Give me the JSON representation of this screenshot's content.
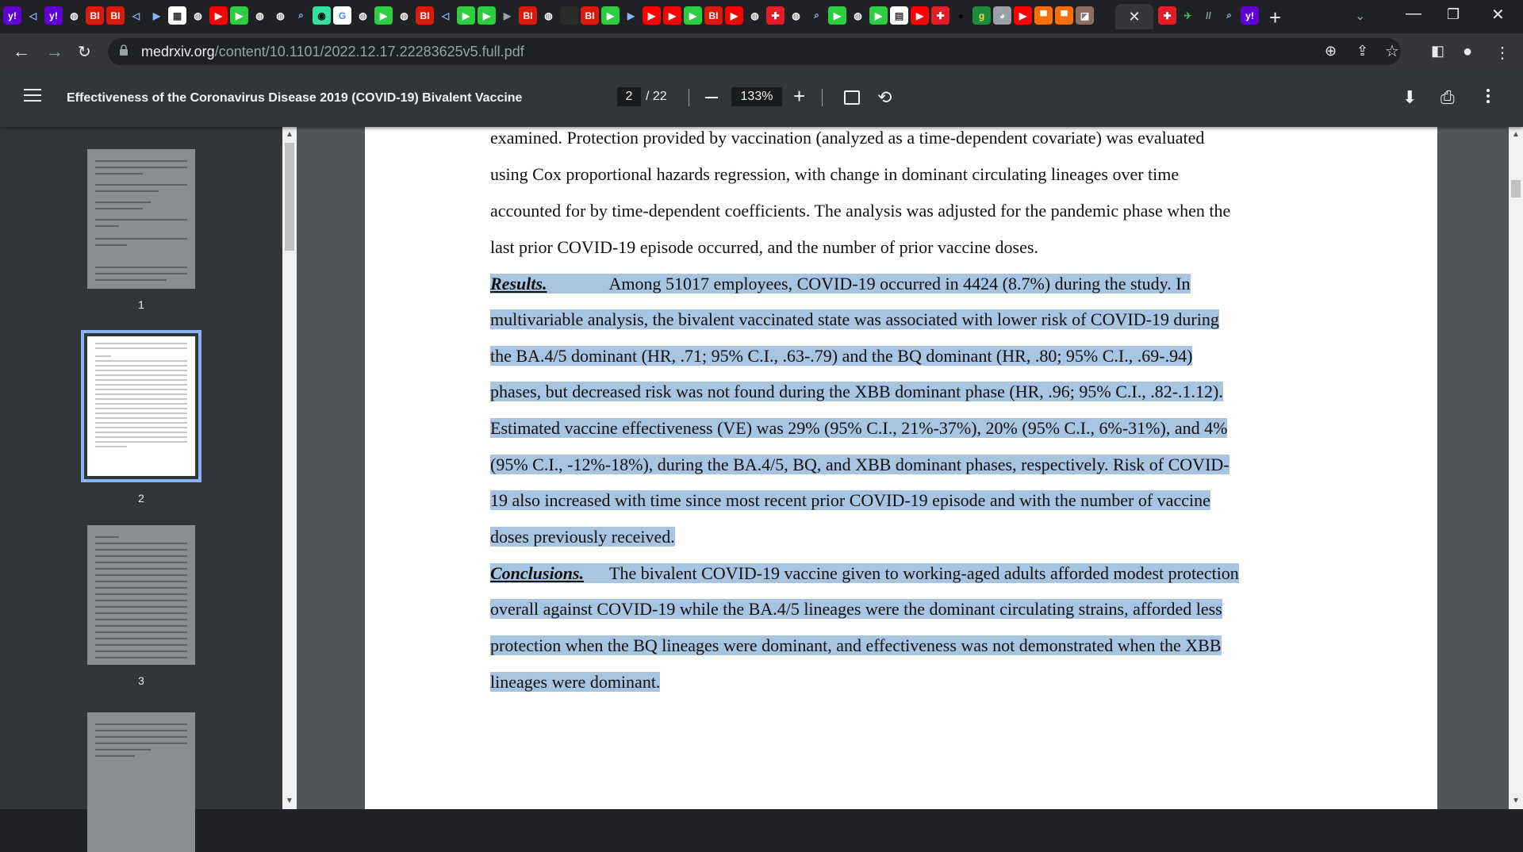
{
  "browser": {
    "tab_favicons": [
      {
        "icon": "yahoo-icon",
        "glyph": "y!",
        "bg": "#5f01d1",
        "fg": "#ffffff"
      },
      {
        "icon": "brave-icon",
        "glyph": "◁",
        "bg": "#202124",
        "fg": "#8ab4f8"
      },
      {
        "icon": "yahoo-icon",
        "glyph": "y!",
        "bg": "#5f01d1",
        "fg": "#ffffff"
      },
      {
        "icon": "globe-icon",
        "glyph": "◍",
        "bg": "#202124",
        "fg": "#ffffff"
      },
      {
        "icon": "bi-icon",
        "glyph": "BI",
        "bg": "#d81b0c",
        "fg": "#ffffff"
      },
      {
        "icon": "bi-icon",
        "glyph": "BI",
        "bg": "#d81b0c",
        "fg": "#ffffff"
      },
      {
        "icon": "brave-icon",
        "glyph": "◁",
        "bg": "#202124",
        "fg": "#8ab4f8"
      },
      {
        "icon": "media-icon",
        "glyph": "▶",
        "bg": "#202124",
        "fg": "#8ab4f8"
      },
      {
        "icon": "qr-icon",
        "glyph": "▦",
        "bg": "#ffffff",
        "fg": "#333333"
      },
      {
        "icon": "globe-icon",
        "glyph": "◍",
        "bg": "#202124",
        "fg": "#ffffff"
      },
      {
        "icon": "youtube-icon",
        "glyph": "▶",
        "bg": "#ff0000",
        "fg": "#ffffff"
      },
      {
        "icon": "play-icon",
        "glyph": "▶",
        "bg": "#2ecc40",
        "fg": "#ffffff"
      },
      {
        "icon": "globe-icon",
        "glyph": "◍",
        "bg": "#202124",
        "fg": "#ffffff"
      },
      {
        "icon": "globe-icon",
        "glyph": "◍",
        "bg": "#202124",
        "fg": "#ffffff"
      },
      {
        "icon": "search-icon",
        "glyph": "⌕",
        "bg": "#202124",
        "fg": "#8ab4f8"
      },
      {
        "icon": "tripadvisor-icon",
        "glyph": "◉",
        "bg": "#34e0a1",
        "fg": "#000000"
      },
      {
        "icon": "google-icon",
        "glyph": "G",
        "bg": "#ffffff",
        "fg": "#4285f4"
      },
      {
        "icon": "globe-icon",
        "glyph": "◍",
        "bg": "#202124",
        "fg": "#ffffff"
      },
      {
        "icon": "play-icon",
        "glyph": "▶",
        "bg": "#2ecc40",
        "fg": "#ffffff"
      },
      {
        "icon": "globe-icon",
        "glyph": "◍",
        "bg": "#202124",
        "fg": "#ffffff"
      },
      {
        "icon": "bi-icon",
        "glyph": "BI",
        "bg": "#d81b0c",
        "fg": "#ffffff"
      },
      {
        "icon": "brave-icon",
        "glyph": "◁",
        "bg": "#202124",
        "fg": "#8ab4f8"
      },
      {
        "icon": "play-icon",
        "glyph": "▶",
        "bg": "#2ecc40",
        "fg": "#ffffff"
      },
      {
        "icon": "play-icon",
        "glyph": "▶",
        "bg": "#2ecc40",
        "fg": "#ffffff"
      },
      {
        "icon": "media-icon",
        "glyph": "▶",
        "bg": "#202124",
        "fg": "#9aa0a6"
      },
      {
        "icon": "bi-icon",
        "glyph": "BI",
        "bg": "#d81b0c",
        "fg": "#ffffff"
      },
      {
        "icon": "globe-icon",
        "glyph": "◍",
        "bg": "#202124",
        "fg": "#ffffff"
      },
      {
        "icon": "blank-icon",
        "glyph": "",
        "bg": "#2b2b2b",
        "fg": "#ffffff"
      },
      {
        "icon": "bi-icon",
        "glyph": "BI",
        "bg": "#d81b0c",
        "fg": "#ffffff"
      },
      {
        "icon": "play-icon",
        "glyph": "▶",
        "bg": "#2ecc40",
        "fg": "#ffffff"
      },
      {
        "icon": "media-icon",
        "glyph": "▶",
        "bg": "#202124",
        "fg": "#8ab4f8"
      },
      {
        "icon": "youtube-icon",
        "glyph": "▶",
        "bg": "#ff0000",
        "fg": "#ffffff"
      },
      {
        "icon": "youtube-icon",
        "glyph": "▶",
        "bg": "#ff0000",
        "fg": "#ffffff"
      },
      {
        "icon": "play-icon",
        "glyph": "▶",
        "bg": "#2ecc40",
        "fg": "#ffffff"
      },
      {
        "icon": "bi-icon",
        "glyph": "BI",
        "bg": "#d81b0c",
        "fg": "#ffffff"
      },
      {
        "icon": "youtube-icon",
        "glyph": "▶",
        "bg": "#ff0000",
        "fg": "#ffffff"
      },
      {
        "icon": "globe-icon",
        "glyph": "◍",
        "bg": "#202124",
        "fg": "#ffffff"
      },
      {
        "icon": "gift-icon",
        "glyph": "✚",
        "bg": "#e41e26",
        "fg": "#ffffff"
      },
      {
        "icon": "globe-icon",
        "glyph": "◍",
        "bg": "#202124",
        "fg": "#ffffff"
      },
      {
        "icon": "search-icon",
        "glyph": "⌕",
        "bg": "#202124",
        "fg": "#8ab4f8"
      },
      {
        "icon": "play-icon",
        "glyph": "▶",
        "bg": "#2ecc40",
        "fg": "#ffffff"
      },
      {
        "icon": "globe-icon",
        "glyph": "◍",
        "bg": "#202124",
        "fg": "#ffffff"
      },
      {
        "icon": "play-icon",
        "glyph": "▶",
        "bg": "#2ecc40",
        "fg": "#ffffff"
      },
      {
        "icon": "news-icon",
        "glyph": "▤",
        "bg": "#ffffff",
        "fg": "#333333"
      },
      {
        "icon": "youtube-icon",
        "glyph": "▶",
        "bg": "#ff0000",
        "fg": "#ffffff"
      },
      {
        "icon": "gift-icon",
        "glyph": "✚",
        "bg": "#e41e26",
        "fg": "#ffffff"
      },
      {
        "icon": "circle-icon",
        "glyph": "●",
        "bg": "#202124",
        "fg": "#000000"
      },
      {
        "icon": "g-icon",
        "glyph": "g",
        "bg": "#1e8a3c",
        "fg": "#ffd54f"
      },
      {
        "icon": "avatar-icon",
        "glyph": "◕",
        "bg": "#9aa0a6",
        "fg": "#ffffff"
      },
      {
        "icon": "youtube-icon",
        "glyph": "▶",
        "bg": "#ff0000",
        "fg": "#ffffff"
      },
      {
        "icon": "bookmark-icon",
        "glyph": "▀",
        "bg": "#ff6f00",
        "fg": "#ffffff"
      },
      {
        "icon": "bookmark-icon",
        "glyph": "▀",
        "bg": "#ff6f00",
        "fg": "#ffffff"
      },
      {
        "icon": "photo-icon",
        "glyph": "◪",
        "bg": "#8d6e63",
        "fg": "#ffffff"
      }
    ],
    "active_tab_close": "✕",
    "tail_favicons": [
      {
        "icon": "gift-icon",
        "glyph": "✚",
        "bg": "#e41e26",
        "fg": "#ffffff"
      },
      {
        "icon": "shopping-icon",
        "glyph": "✈",
        "bg": "#202124",
        "fg": "#4caf50"
      },
      {
        "icon": "grid-icon",
        "glyph": "//",
        "bg": "#202124",
        "fg": "#9aa0a6"
      },
      {
        "icon": "search-icon",
        "glyph": "⌕",
        "bg": "#202124",
        "fg": "#8ab4f8"
      },
      {
        "icon": "yahoo-icon",
        "glyph": "y!",
        "bg": "#5f01d1",
        "fg": "#ffffff"
      }
    ],
    "new_tab_glyph": "+",
    "url_host": "medrxiv.org",
    "url_path": "/content/10.1101/2022.12.17.22283625v5.full.pdf"
  },
  "pdf_toolbar": {
    "title": "Effectiveness of the Coronavirus Disease 2019 (COVID-19) Bivalent Vaccine",
    "current_page": "2",
    "total_pages": "/ 22",
    "zoom": "133%"
  },
  "sidebar": {
    "thumbnails": [
      {
        "label": "1"
      },
      {
        "label": "2"
      },
      {
        "label": "3"
      }
    ]
  },
  "document": {
    "lines": [
      {
        "label": "",
        "text": "examined. Protection provided by vaccination (analyzed as a time-dependent covariate) was evaluated",
        "hl": false
      },
      {
        "label": "",
        "text": "using Cox proportional hazards regression, with change in dominant circulating lineages over time",
        "hl": false
      },
      {
        "label": "",
        "text": "accounted for by time-dependent coefficients. The analysis was adjusted for the pandemic phase when the",
        "hl": false
      },
      {
        "label": "",
        "text": "last prior COVID-19 episode occurred, and the number of prior vaccine doses.",
        "hl": false
      },
      {
        "label": "Results.",
        "text": "Among 51017 employees, COVID-19 occurred in 4424 (8.7%) during the study. In",
        "hl": true
      },
      {
        "label": "",
        "text": "multivariable analysis, the bivalent vaccinated state was associated with lower risk of COVID-19 during",
        "hl": true
      },
      {
        "label": "",
        "text": "the BA.4/5 dominant (HR, .71; 95% C.I., .63-.79) and the BQ dominant (HR, .80; 95% C.I., .69-.94)",
        "hl": true
      },
      {
        "label": "",
        "text": "phases, but decreased risk was not found during the XBB dominant phase (HR, .96; 95% C.I., .82-.1.12).",
        "hl": true
      },
      {
        "label": "",
        "text": "Estimated vaccine effectiveness (VE) was 29% (95% C.I., 21%-37%), 20% (95% C.I., 6%-31%), and 4%",
        "hl": true
      },
      {
        "label": "",
        "text": "(95% C.I., -12%-18%), during the BA.4/5, BQ, and XBB dominant phases, respectively. Risk of COVID-",
        "hl": true
      },
      {
        "label": "",
        "text": "19 also increased with time since most recent prior COVID-19 episode and with the number of vaccine",
        "hl": true
      },
      {
        "label": "",
        "text": "doses previously received.",
        "hl": true
      },
      {
        "label": "Conclusions.",
        "text": "The bivalent COVID-19 vaccine given to working-aged adults afforded modest protection",
        "hl": true
      },
      {
        "label": "",
        "text": "overall against COVID-19 while the BA.4/5 lineages were the dominant circulating strains, afforded less",
        "hl": true
      },
      {
        "label": "",
        "text": "protection when the BQ lineages were dominant, and effectiveness was not demonstrated when the XBB",
        "hl": true
      },
      {
        "label": "",
        "text": "lineages were dominant.",
        "hl": true
      }
    ]
  },
  "colors": {
    "selection": "#a9c4e0",
    "toolbar_bg": "#323639",
    "viewer_bg": "#525659"
  }
}
